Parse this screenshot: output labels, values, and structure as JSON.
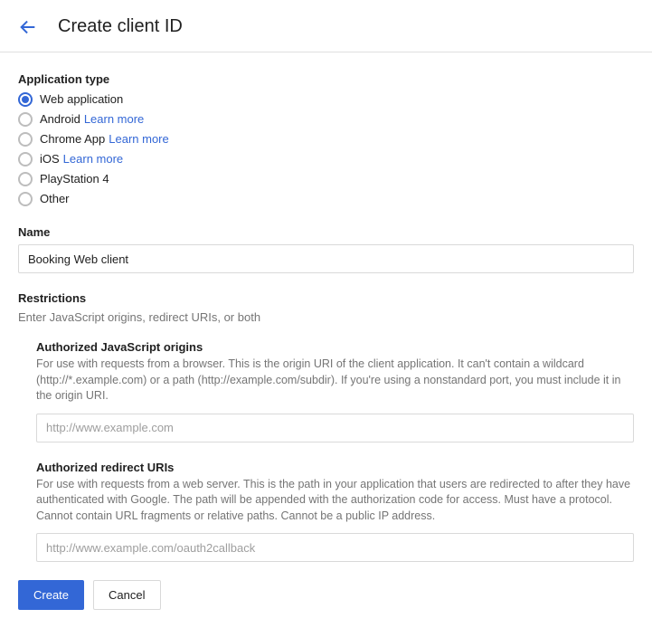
{
  "header": {
    "title": "Create client ID"
  },
  "app_type": {
    "label": "Application type",
    "options": [
      {
        "label": "Web application",
        "selected": true,
        "learn_more": null
      },
      {
        "label": "Android",
        "selected": false,
        "learn_more": "Learn more"
      },
      {
        "label": "Chrome App",
        "selected": false,
        "learn_more": "Learn more"
      },
      {
        "label": "iOS",
        "selected": false,
        "learn_more": "Learn more"
      },
      {
        "label": "PlayStation 4",
        "selected": false,
        "learn_more": null
      },
      {
        "label": "Other",
        "selected": false,
        "learn_more": null
      }
    ]
  },
  "name": {
    "label": "Name",
    "value": "Booking Web client"
  },
  "restrictions": {
    "label": "Restrictions",
    "hint": "Enter JavaScript origins, redirect URIs, or both",
    "js_origins": {
      "label": "Authorized JavaScript origins",
      "desc": "For use with requests from a browser. This is the origin URI of the client application. It can't contain a wildcard (http://*.example.com) or a path (http://example.com/subdir). If you're using a nonstandard port, you must include it in the origin URI.",
      "placeholder": "http://www.example.com"
    },
    "redirect_uris": {
      "label": "Authorized redirect URIs",
      "desc": "For use with requests from a web server. This is the path in your application that users are redirected to after they have authenticated with Google. The path will be appended with the authorization code for access. Must have a protocol. Cannot contain URL fragments or relative paths. Cannot be a public IP address.",
      "placeholder": "http://www.example.com/oauth2callback"
    }
  },
  "actions": {
    "create": "Create",
    "cancel": "Cancel"
  }
}
